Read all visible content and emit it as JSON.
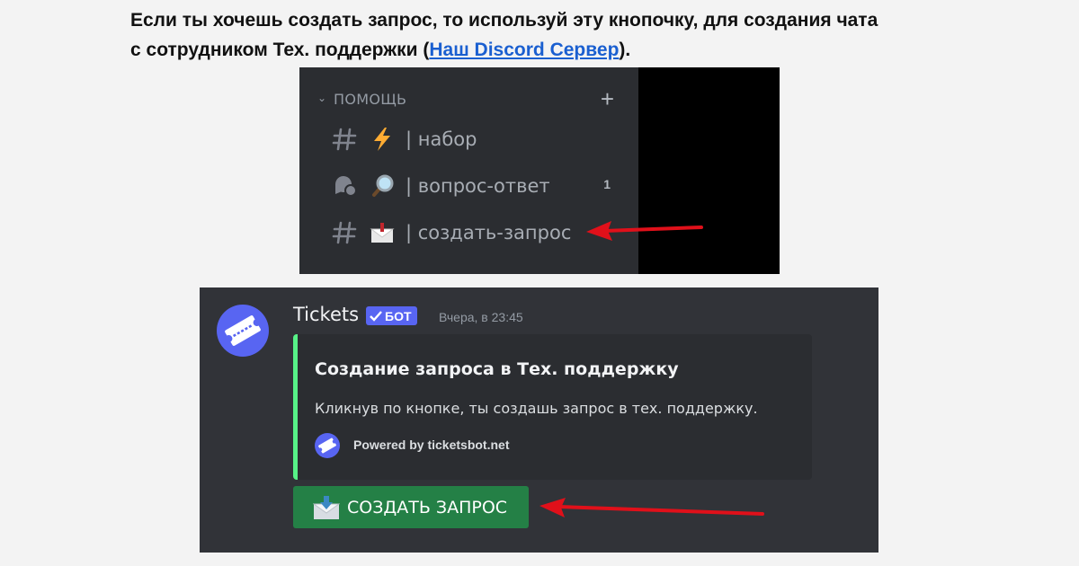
{
  "intro": {
    "line1": "Если ты хочешь создать запрос, то используй эту кнопочку, для создания чата",
    "line2_before": "с сотрудником Тех. поддержки (",
    "link_text": "Наш Discord Сервер",
    "line2_after": ")."
  },
  "channel_list": {
    "category": "ПОМОЩЬ",
    "add_symbol": "+",
    "channels": [
      {
        "icon": "hash-icon",
        "emoji": "lightning-emoji",
        "name": "| набор",
        "badge": ""
      },
      {
        "icon": "forum-icon",
        "emoji": "magnifier-emoji",
        "name": "| вопрос-ответ",
        "badge": "1"
      },
      {
        "icon": "hash-icon",
        "emoji": "inbox-emoji",
        "name": "| создать-запрос",
        "badge": ""
      }
    ]
  },
  "message": {
    "author": "Tickets",
    "bot_tag": "БОТ",
    "timestamp": "Вчера, в 23:45",
    "embed": {
      "accent_color": "#57f287",
      "title": "Создание запроса в Тех. поддержку",
      "description": "Кликнув по кнопке, ты создашь запрос в тех. поддержку.",
      "footer": "Powered by ticketsbot.net"
    },
    "button": {
      "label": "СОЗДАТЬ ЗАПРОС",
      "icon": "envelope-download-icon",
      "color": "#248046"
    }
  },
  "colors": {
    "discord_sidebar": "#2b2d31",
    "discord_chat": "#313338",
    "blurple": "#5865f2",
    "arrow_red": "#e0101a"
  }
}
